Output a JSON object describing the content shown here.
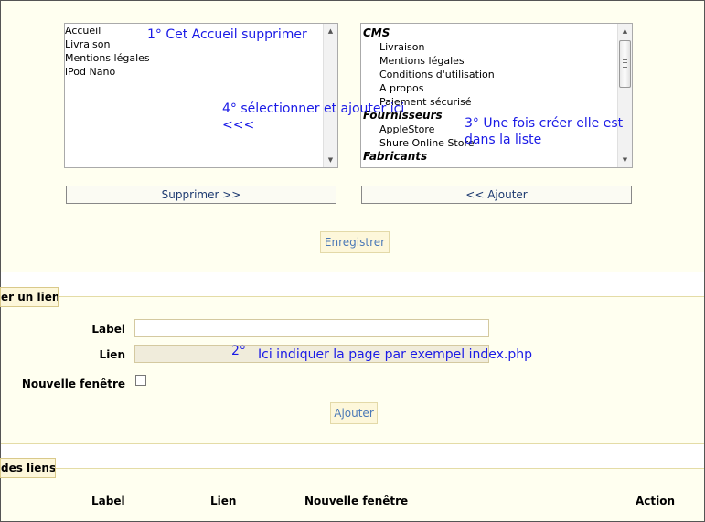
{
  "left_list": {
    "items": [
      "Accueil",
      "Livraison",
      "Mentions légales",
      "iPod Nano"
    ]
  },
  "right_list": {
    "groups": [
      {
        "name": "CMS",
        "items": [
          "Livraison",
          "Mentions légales",
          "Conditions d'utilisation",
          "A propos",
          "Paiement sécurisé"
        ]
      },
      {
        "name": "Fournisseurs",
        "items": [
          "AppleStore",
          "Shure Online Store"
        ]
      },
      {
        "name": "Fabricants",
        "items": []
      }
    ]
  },
  "annotations": {
    "a1": "1° Cet Accueil supprimer",
    "a4_line1": "4° sélectionner et ajouter ici",
    "a4_line2": "<<<",
    "a3_line1": "3° Une fois créer elle est",
    "a3_line2": "dans la liste",
    "a2_num": "2°",
    "a2_text": "Ici indiquer la page par exempel index.php"
  },
  "buttons": {
    "remove": "Supprimer >>",
    "add_to_list": "<< Ajouter",
    "save": "Enregistrer",
    "add_link": "Ajouter"
  },
  "add_link_section": {
    "legend": "er un lien",
    "label_field": "Label",
    "link_field": "Lien",
    "new_window_field": "Nouvelle fenêtre"
  },
  "links_section": {
    "legend": "des liens",
    "columns": [
      "Label",
      "Lien",
      "Nouvelle fenêtre",
      "Action"
    ]
  }
}
